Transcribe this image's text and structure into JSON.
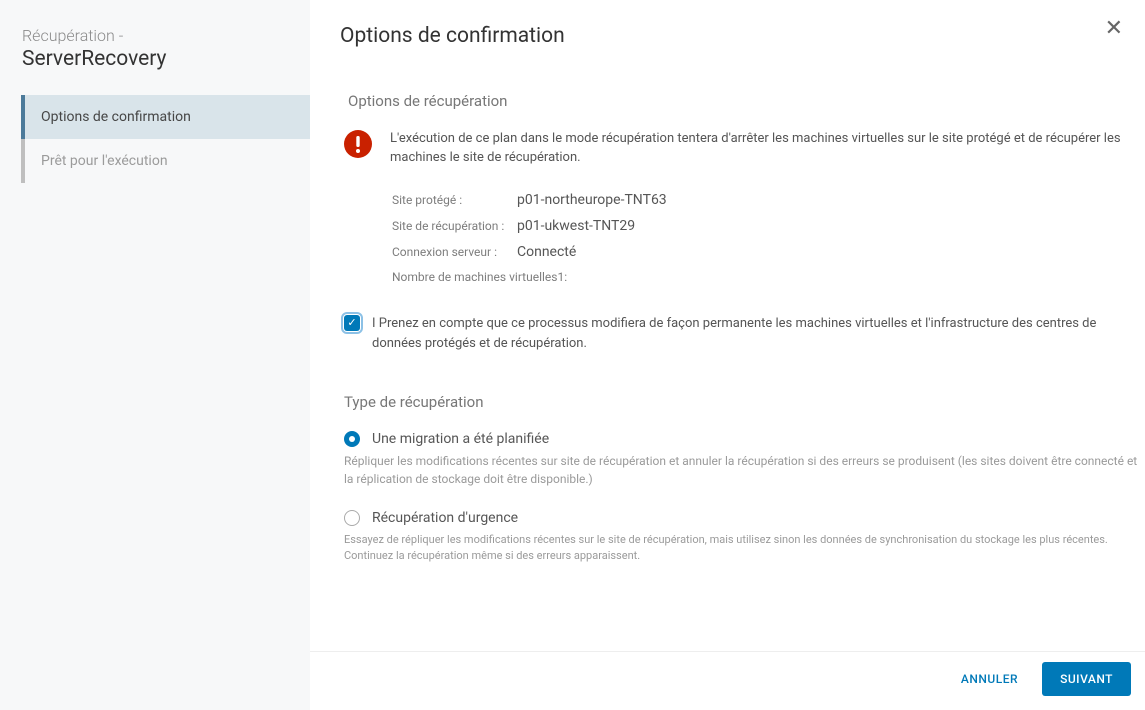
{
  "sidebar": {
    "breadcrumb": "Récupération -",
    "title": "ServerRecovery",
    "steps": [
      {
        "label": "Options de confirmation"
      },
      {
        "label": "Prêt pour l'exécution"
      }
    ]
  },
  "main": {
    "title": "Options de confirmation",
    "recovery_options": {
      "heading": "Options de récupération",
      "warning": "L'exécution de ce plan dans le mode récupération tentera d'arrêter les machines virtuelles sur le site protégé et de récupérer les machines le site de récupération.",
      "rows": {
        "protected_site_label": "Site protégé :",
        "protected_site_value": "p01-northeurope-TNT63",
        "recovery_site_label": "Site de récupération :",
        "recovery_site_value": "p01-ukwest-TNT29",
        "server_conn_label": "Connexion serveur :",
        "server_conn_value": "Connecté",
        "vm_count_label": "Nombre de machines virtuelles1:"
      },
      "ack_prefix": "I ",
      "ack_text": "Prenez en compte que ce processus modifiera de façon permanente les machines virtuelles et l'infrastructure des centres de données protégés et de récupération."
    },
    "recovery_type": {
      "heading": "Type de récupération",
      "option1_label": "Une migration a été planifiée",
      "option1_desc": "Répliquer les modifications récentes sur site de récupération et annuler la récupération si des erreurs se produisent (les sites doivent être connecté et la réplication de stockage doit être disponible.)",
      "option2_label": "Récupération d'urgence",
      "option2_desc": "Essayez de répliquer les modifications récentes sur le site de récupération, mais utilisez sinon les données de synchronisation du stockage les plus récentes. Continuez la récupération même si des erreurs apparaissent."
    }
  },
  "footer": {
    "cancel": "ANNULER",
    "next": "SUIVANT"
  }
}
